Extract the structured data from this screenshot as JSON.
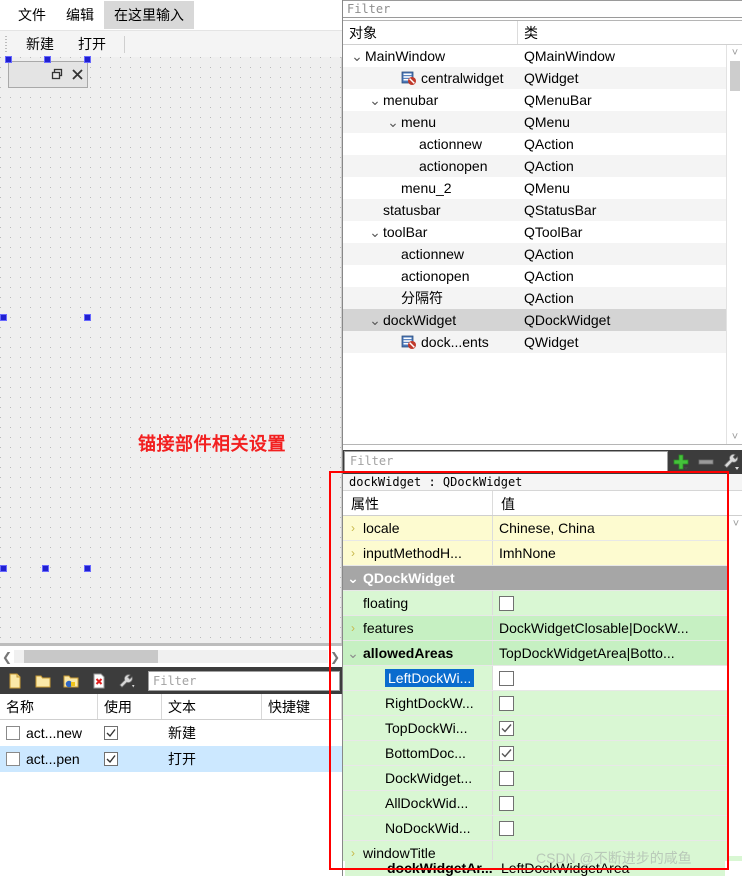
{
  "form_editor": {
    "menubar": [
      {
        "label": "文件",
        "highlighted": false
      },
      {
        "label": "编辑",
        "highlighted": false
      },
      {
        "label": "在这里输入",
        "highlighted": true
      }
    ],
    "toolbar": [
      {
        "label": "新建"
      },
      {
        "label": "打开"
      }
    ],
    "annotation": "锚接部件相关设置",
    "dock_preview": {
      "float_icon": "restore-icon",
      "close_icon": "close-icon"
    }
  },
  "action_editor": {
    "toolbar_icons": [
      "new-action-icon",
      "new-action-from-folder-icon",
      "edit-action-icon",
      "delete-action-icon",
      "view-mode-icon"
    ],
    "filter_placeholder": "Filter",
    "columns": [
      "名称",
      "使用",
      "文本",
      "快捷键"
    ],
    "rows": [
      {
        "name": "act...new",
        "used": true,
        "text": "新建",
        "shortcut": "",
        "selected": false
      },
      {
        "name": "act...pen",
        "used": true,
        "text": "打开",
        "shortcut": "",
        "selected": true
      }
    ]
  },
  "object_inspector": {
    "filter_placeholder": "Filter",
    "columns": [
      "对象",
      "类"
    ],
    "rows": [
      {
        "name": "MainWindow",
        "cls": "QMainWindow",
        "indent": 0,
        "arrow": "down",
        "icon": "",
        "selected": false,
        "alt": false
      },
      {
        "name": "centralwidget",
        "cls": "QWidget",
        "indent": 2,
        "arrow": "",
        "icon": "widget-forbidden-icon",
        "selected": false,
        "alt": true
      },
      {
        "name": "menubar",
        "cls": "QMenuBar",
        "indent": 1,
        "arrow": "down",
        "icon": "",
        "selected": false,
        "alt": false
      },
      {
        "name": "menu",
        "cls": "QMenu",
        "indent": 2,
        "arrow": "down",
        "icon": "",
        "selected": false,
        "alt": true
      },
      {
        "name": "actionnew",
        "cls": "QAction",
        "indent": 3,
        "arrow": "",
        "icon": "",
        "selected": false,
        "alt": false
      },
      {
        "name": "actionopen",
        "cls": "QAction",
        "indent": 3,
        "arrow": "",
        "icon": "",
        "selected": false,
        "alt": true
      },
      {
        "name": "menu_2",
        "cls": "QMenu",
        "indent": 2,
        "arrow": "",
        "icon": "",
        "selected": false,
        "alt": false
      },
      {
        "name": "statusbar",
        "cls": "QStatusBar",
        "indent": 1,
        "arrow": "",
        "icon": "",
        "selected": false,
        "alt": true
      },
      {
        "name": "toolBar",
        "cls": "QToolBar",
        "indent": 1,
        "arrow": "down",
        "icon": "",
        "selected": false,
        "alt": false
      },
      {
        "name": "actionnew",
        "cls": "QAction",
        "indent": 2,
        "arrow": "",
        "icon": "",
        "selected": false,
        "alt": true
      },
      {
        "name": "actionopen",
        "cls": "QAction",
        "indent": 2,
        "arrow": "",
        "icon": "",
        "selected": false,
        "alt": false
      },
      {
        "name": "分隔符",
        "cls": "QAction",
        "indent": 2,
        "arrow": "",
        "icon": "",
        "selected": false,
        "alt": true
      },
      {
        "name": "dockWidget",
        "cls": "QDockWidget",
        "indent": 1,
        "arrow": "down",
        "icon": "",
        "selected": true,
        "alt": false
      },
      {
        "name": "dock...ents",
        "cls": "QWidget",
        "indent": 2,
        "arrow": "",
        "icon": "widget-forbidden-icon",
        "selected": false,
        "alt": true
      }
    ]
  },
  "property_editor": {
    "filter_placeholder": "Filter",
    "buttons": [
      {
        "name": "add-property-button",
        "glyph": "+"
      },
      {
        "name": "remove-property-button",
        "glyph": "−"
      },
      {
        "name": "configure-button",
        "glyph": "wrench"
      }
    ],
    "object_title": "dockWidget : QDockWidget",
    "columns": [
      "属性",
      "值"
    ],
    "rows": [
      {
        "key": "locale",
        "value": "Chinese, China",
        "style": "yellow",
        "arrow": "right",
        "indent": 0,
        "checkbox": null,
        "key_selected": false
      },
      {
        "key": "inputMethodH...",
        "value": "ImhNone",
        "style": "yellow",
        "arrow": "right",
        "indent": 0,
        "checkbox": null,
        "key_selected": false
      },
      {
        "key": "QDockWidget",
        "value": "",
        "style": "group",
        "arrow": "down",
        "indent": 0,
        "checkbox": null,
        "key_selected": false
      },
      {
        "key": "floating",
        "value": "",
        "style": "greenlt",
        "arrow": "",
        "indent": 0,
        "checkbox": false,
        "key_selected": false
      },
      {
        "key": "features",
        "value": "DockWidgetClosable|DockW...",
        "style": "green",
        "arrow": "right",
        "indent": 0,
        "checkbox": null,
        "key_selected": false
      },
      {
        "key": "allowedAreas",
        "value": "TopDockWidgetArea|Botto...",
        "style": "green",
        "arrow": "down",
        "indent": 0,
        "checkbox": null,
        "key_selected": false,
        "bold": true
      },
      {
        "key": "LeftDockWi...",
        "value": "",
        "style": "greenlt",
        "arrow": "",
        "indent": 1,
        "checkbox": false,
        "key_selected": true,
        "value_white": true
      },
      {
        "key": "RightDockW...",
        "value": "",
        "style": "greenlt",
        "arrow": "",
        "indent": 1,
        "checkbox": false,
        "key_selected": false
      },
      {
        "key": "TopDockWi...",
        "value": "",
        "style": "greenlt",
        "arrow": "",
        "indent": 1,
        "checkbox": true,
        "key_selected": false
      },
      {
        "key": "BottomDoc...",
        "value": "",
        "style": "greenlt",
        "arrow": "",
        "indent": 1,
        "checkbox": true,
        "key_selected": false
      },
      {
        "key": "DockWidget...",
        "value": "",
        "style": "greenlt",
        "arrow": "",
        "indent": 1,
        "checkbox": false,
        "key_selected": false
      },
      {
        "key": "AllDockWid...",
        "value": "",
        "style": "greenlt",
        "arrow": "",
        "indent": 1,
        "checkbox": false,
        "key_selected": false
      },
      {
        "key": "NoDockWid...",
        "value": "",
        "style": "greenlt",
        "arrow": "",
        "indent": 1,
        "checkbox": false,
        "key_selected": false
      },
      {
        "key": "windowTitle",
        "value": "",
        "style": "greenlt",
        "arrow": "right",
        "indent": 0,
        "checkbox": null,
        "key_selected": false
      }
    ],
    "last_row": {
      "key": "dockWidgetAr...",
      "value": "LeftDockWidgetArea"
    }
  },
  "watermark": "CSDN @不断进步的咸鱼",
  "colors": {
    "annotation_red": "#f22020",
    "highlight_box_red": "#ff0000",
    "selection_blue": "#0a6cce",
    "row_yellow": "#fdfbd0",
    "row_green": "#c6f0c2",
    "row_green_light": "#d9f7d3",
    "group_grey": "#a6a6a6"
  }
}
